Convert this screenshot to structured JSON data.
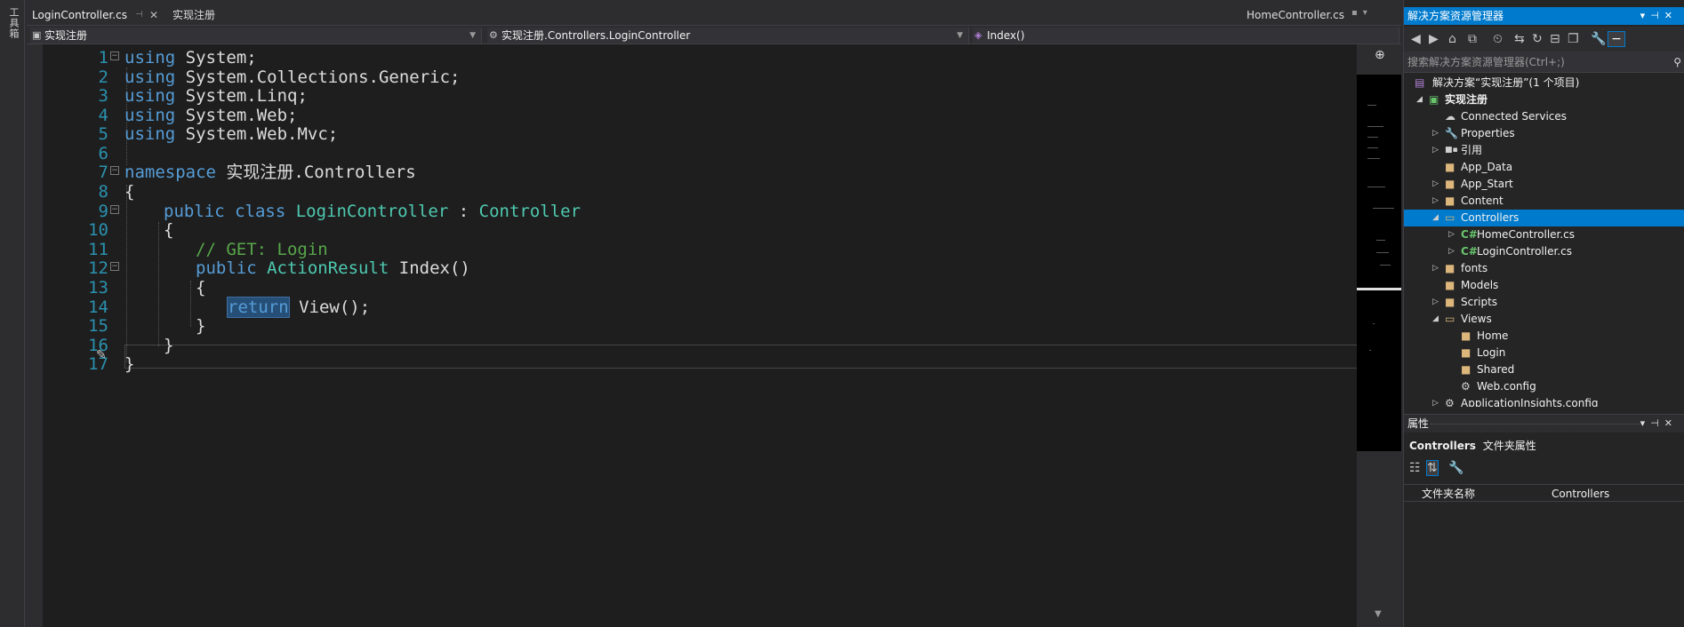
{
  "toolbox": {
    "label": "工具箱"
  },
  "tabs": {
    "active": "LoginController.cs",
    "project": "实现注册",
    "right": "HomeController.cs"
  },
  "navbar": {
    "project": "实现注册",
    "class": "实现注册.Controllers.LoginController",
    "member": "Index()"
  },
  "code": {
    "line_numbers": [
      "1",
      "2",
      "3",
      "4",
      "5",
      "6",
      "7",
      "8",
      "9",
      "10",
      "11",
      "12",
      "13",
      "14",
      "15",
      "16",
      "17"
    ],
    "l1": {
      "kw": "using",
      "rest": " System;"
    },
    "l2": {
      "kw": "using",
      "rest": " System.Collections.Generic;"
    },
    "l3": {
      "kw": "using",
      "rest": " System.Linq;"
    },
    "l4": {
      "kw": "using",
      "rest": " System.Web;"
    },
    "l5": {
      "kw": "using",
      "rest": " System.Web.Mvc;"
    },
    "l7": {
      "kw": "namespace",
      "rest": " 实现注册.Controllers"
    },
    "l8": "{",
    "l9": {
      "kw1": "public",
      "kw2": " class ",
      "ty": "LoginController",
      "mid": " : ",
      "base": "Controller"
    },
    "l10": "{",
    "l11": "// GET: Login",
    "l12": {
      "kw": "public",
      "ty": " ActionResult",
      "rest": " Index()"
    },
    "l13": "{",
    "l14": {
      "kw": "return",
      "rest": " View();"
    },
    "l15": "}",
    "l16": "}",
    "l17": "}"
  },
  "solution_explorer": {
    "title": "解决方案资源管理器",
    "search_placeholder": "搜索解决方案资源管理器(Ctrl+;)",
    "tree": [
      {
        "label": "解决方案“实现注册”(1 个项目)"
      },
      {
        "label": "实现注册"
      },
      {
        "label": "Connected Services"
      },
      {
        "label": "Properties"
      },
      {
        "label": "引用"
      },
      {
        "label": "App_Data"
      },
      {
        "label": "App_Start"
      },
      {
        "label": "Content"
      },
      {
        "label": "Controllers"
      },
      {
        "label": "HomeController.cs"
      },
      {
        "label": "LoginController.cs"
      },
      {
        "label": "fonts"
      },
      {
        "label": "Models"
      },
      {
        "label": "Scripts"
      },
      {
        "label": "Views"
      },
      {
        "label": "Home"
      },
      {
        "label": "Login"
      },
      {
        "label": "Shared"
      },
      {
        "label": "Web.config"
      },
      {
        "label": "ApplicationInsights.config"
      }
    ]
  },
  "properties": {
    "title": "属性",
    "object": "Controllers",
    "kind": "文件夹属性",
    "row_name": "文件夹名称",
    "row_value": "Controllers"
  },
  "colors": {
    "accent": "#007acc",
    "keyword": "#569cd6",
    "type": "#4ec9b0",
    "comment": "#57a64a",
    "linenum": "#2b91af"
  }
}
